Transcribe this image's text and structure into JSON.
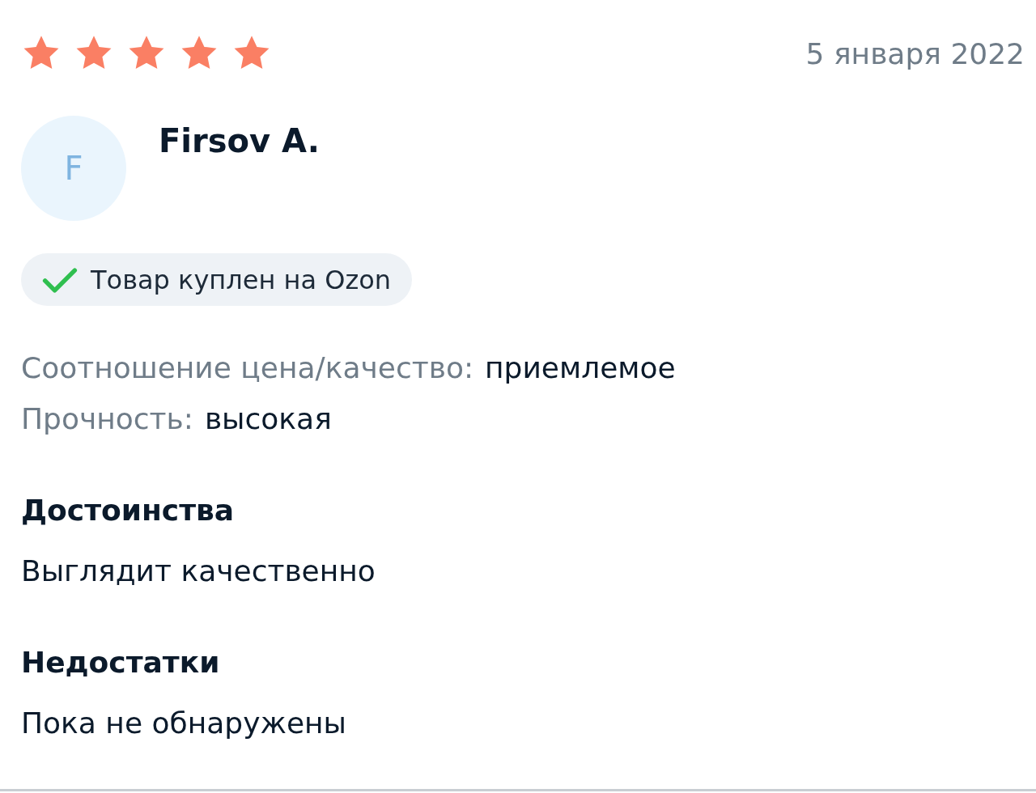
{
  "review": {
    "stars": 5,
    "date": "5 января 2022",
    "avatar_letter": "F",
    "author": "Firsov A.",
    "badge": {
      "label": "Товар куплен на Ozon"
    },
    "attributes": [
      {
        "label": "Соотношение цена/качество:",
        "value": "приемлемое"
      },
      {
        "label": "Прочность:",
        "value": "высокая"
      }
    ],
    "sections": [
      {
        "heading": "Достоинства",
        "text": "Выглядит качественно"
      },
      {
        "heading": "Недостатки",
        "text": "Пока не обнаружены"
      }
    ]
  }
}
